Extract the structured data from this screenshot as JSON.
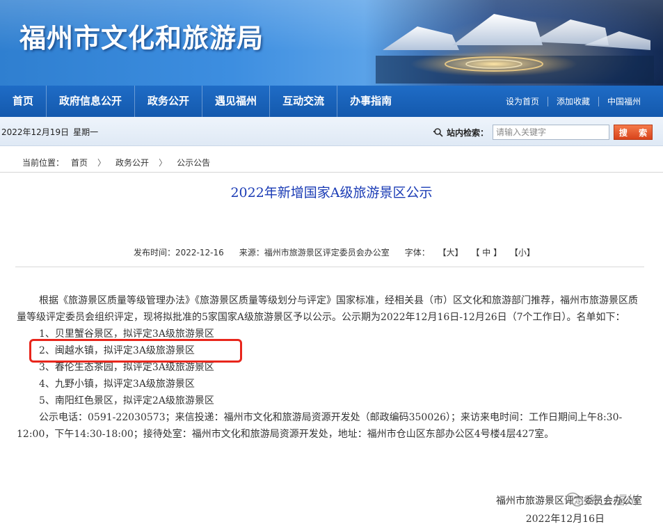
{
  "site": {
    "title": "福州市文化和旅游局"
  },
  "nav": {
    "items": [
      "首页",
      "政府信息公开",
      "政务公开",
      "遇见福州",
      "互动交流",
      "办事指南"
    ],
    "links": [
      "设为首页",
      "添加收藏",
      "中国福州"
    ]
  },
  "infobar": {
    "date": "2022年12月19日",
    "weekday": "星期一",
    "search_label": "站内检索：",
    "search_placeholder": "请输入关键字",
    "search_button": "搜 索"
  },
  "breadcrumb": {
    "prefix": "当前位置：",
    "items": [
      "首页",
      "政务公开",
      "公示公告"
    ],
    "separator": "〉"
  },
  "article": {
    "title": "2022年新增国家A级旅游景区公示",
    "meta": {
      "publish": "发布时间：2022-12-16",
      "source": "来源：福州市旅游景区评定委员会办公室",
      "font_label": "字体：",
      "font_large": "【大】",
      "font_medium": "【 中 】",
      "font_small": "【小】"
    },
    "intro": "根据《旅游景区质量等级管理办法》《旅游景区质量等级划分与评定》国家标准，经相关县（市）区文化和旅游部门推荐，福州市旅游景区质量等级评定委员会组织评定，现将拟批准的5家国家A级旅游景区予以公示。公示期为2022年12月16日-12月26日（7个工作日）。名单如下：",
    "list": [
      "1、贝里蟹谷景区，拟评定3A级旅游景区",
      "2、闽越水镇，拟评定3A级旅游景区",
      "3、春伦生态茶园，拟评定3A级旅游景区",
      "4、九野小镇，拟评定3A级旅游景区",
      "5、南阳红色景区，拟评定2A级旅游景区"
    ],
    "contact": "公示电话：0591-22030573；来信投递：福州市文化和旅游局资源开发处（邮政编码350026）；来访来电时间：工作日期间上午8:30-12:00，下午14:30-18:00；接待处室：福州市文化和旅游局资源开发处，地址：福州市仓山区东部办公区4号楼4层427室。",
    "signature": "福州市旅游景区评定委员会办公室",
    "sign_date": "2022年12月16日"
  },
  "watermark": {
    "text": "海上福州"
  },
  "colors": {
    "nav_blue": "#1459ad",
    "title_blue": "#1a3bb5",
    "highlight_red": "#e8261c",
    "search_orange": "#d8431b"
  }
}
